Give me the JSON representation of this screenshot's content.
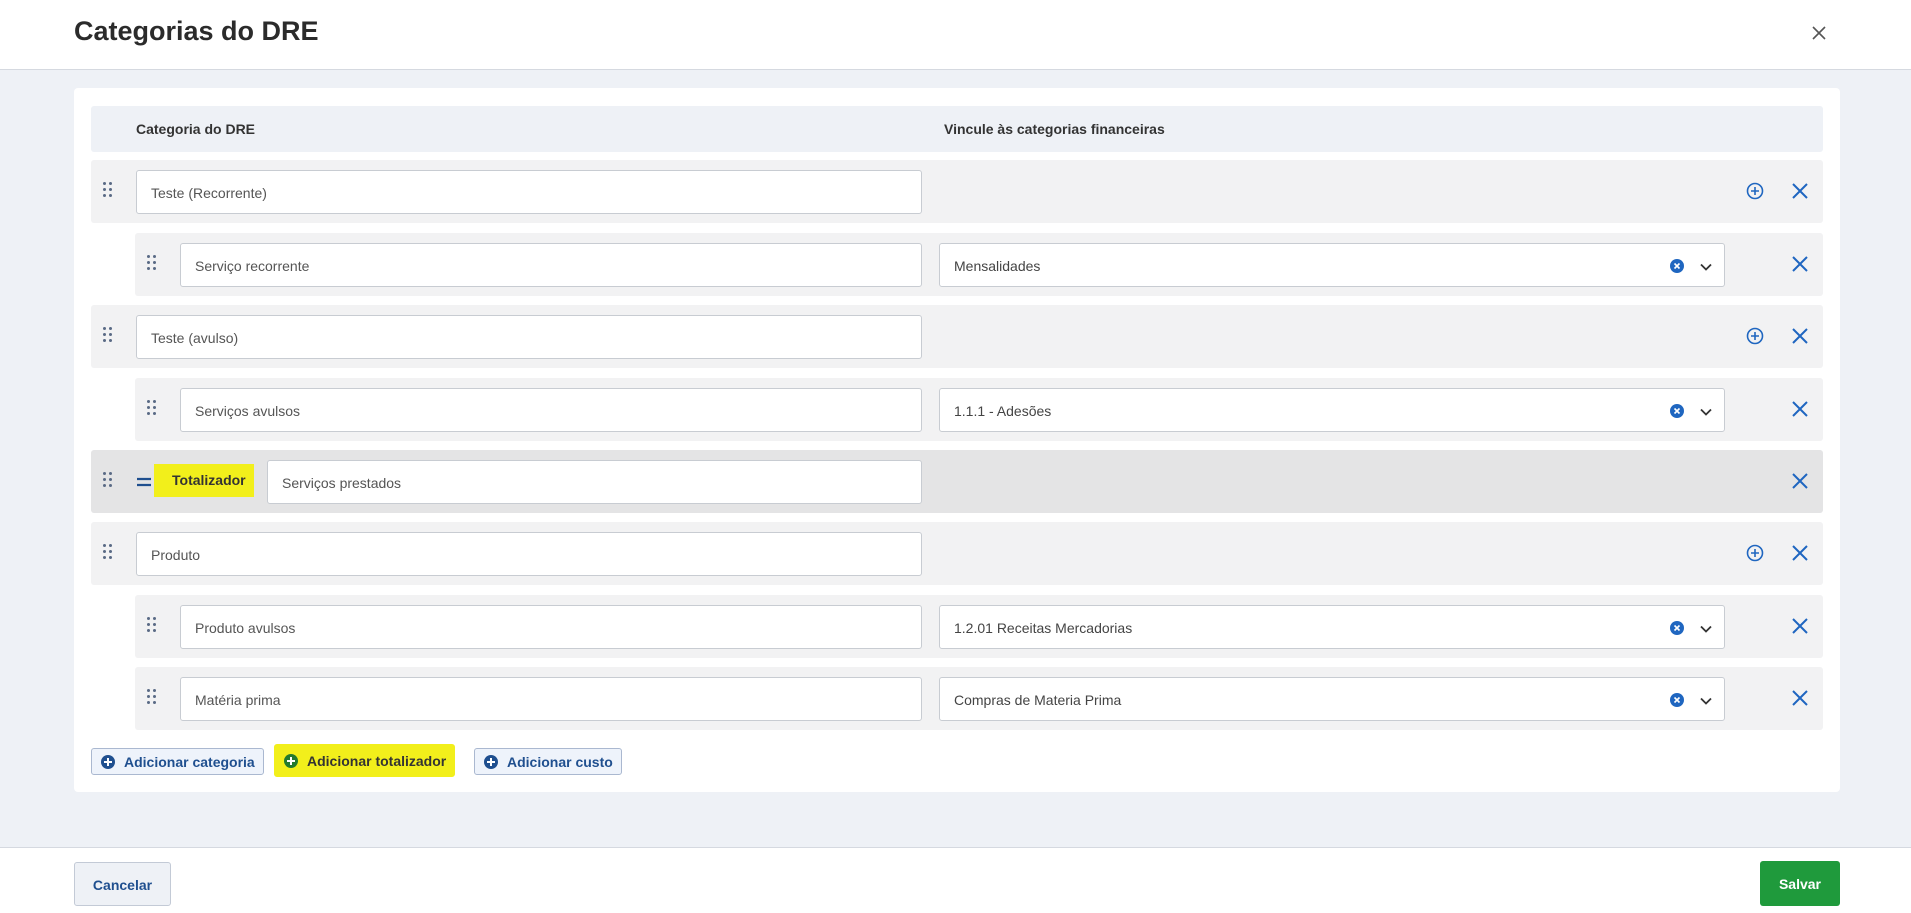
{
  "header": {
    "title": "Categorias do DRE"
  },
  "columns": {
    "category": "Categoria do DRE",
    "link": "Vincule às categorias financeiras"
  },
  "rows": [
    {
      "type": "category",
      "value": "Teste (Recorrente)"
    },
    {
      "type": "subcategory",
      "value": "Serviço recorrente",
      "link": "Mensalidades"
    },
    {
      "type": "category",
      "value": "Teste (avulso)"
    },
    {
      "type": "subcategory",
      "value": "Serviços avulsos",
      "link": "1.1.1 - Adesões"
    },
    {
      "type": "totalizer",
      "label": "Totalizador",
      "value": "Serviços prestados"
    },
    {
      "type": "category",
      "value": "Produto"
    },
    {
      "type": "subcategory",
      "value": "Produto avulsos",
      "link": "1.2.01 Receitas Mercadorias"
    },
    {
      "type": "subcategory",
      "value": "Matéria prima",
      "link": "Compras de Materia Prima"
    }
  ],
  "actions": {
    "add_category": "Adicionar categoria",
    "add_totalizer": "Adicionar totalizador",
    "add_cost": "Adicionar custo"
  },
  "footer": {
    "cancel": "Cancelar",
    "save": "Salvar"
  },
  "colors": {
    "accent_blue": "#1f66c0",
    "highlight_yellow": "#f2ef1b",
    "save_green": "#1f9a3c"
  },
  "icons": {
    "drag": "drag-handle-icon",
    "add": "plus-circle-icon",
    "remove": "close-x-icon",
    "clear": "clear-circle-icon",
    "dropdown": "chevron-down-icon",
    "equals": "equals-icon"
  }
}
